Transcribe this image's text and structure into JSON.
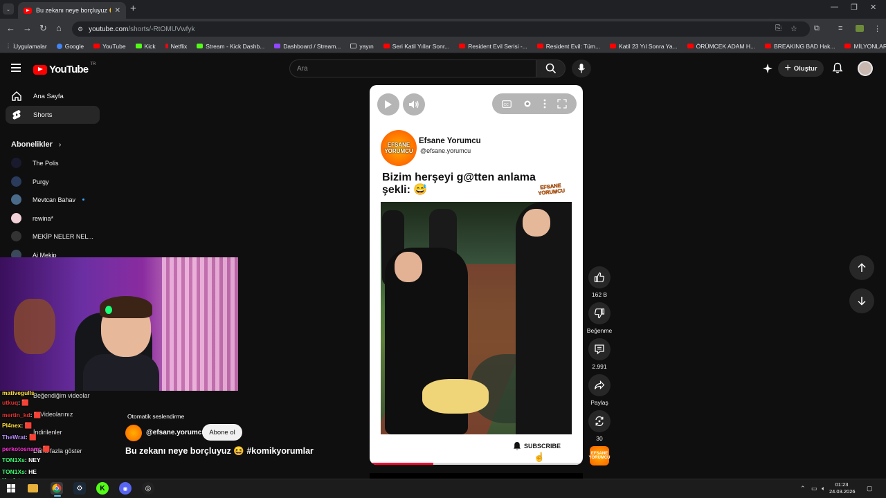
{
  "browser": {
    "tab_title": "Bu zekanı neye borçluyuz 😆 #k",
    "url_host": "youtube.com",
    "url_path": "/shorts/-RtOMUVwfyk",
    "bookmarks": [
      {
        "label": "Uygulamalar",
        "icon": "grid-icon"
      },
      {
        "label": "Google",
        "icon": "google-icon"
      },
      {
        "label": "YouTube",
        "icon": "youtube-icon"
      },
      {
        "label": "Kick",
        "icon": "kick-icon"
      },
      {
        "label": "Netflix",
        "icon": "netflix-icon"
      },
      {
        "label": "Stream - Kick Dashb...",
        "icon": "kick-icon"
      },
      {
        "label": "Dashboard / Stream...",
        "icon": "dashboard-icon"
      },
      {
        "label": "yayın",
        "icon": "folder-icon"
      },
      {
        "label": "Seri Katil Yıllar Sonr...",
        "icon": "youtube-icon"
      },
      {
        "label": "Resident Evil Serisi -...",
        "icon": "youtube-icon"
      },
      {
        "label": "Resident Evil: Tüm...",
        "icon": "youtube-icon"
      },
      {
        "label": "Katil 23 Yıl Sonra Ya...",
        "icon": "youtube-icon"
      },
      {
        "label": "ÖRÜMCEK ADAM H...",
        "icon": "youtube-icon"
      },
      {
        "label": "BREAKING BAD Hak...",
        "icon": "youtube-icon"
      },
      {
        "label": "MİLYONLAR ÇALAR...",
        "icon": "youtube-icon"
      }
    ]
  },
  "yt": {
    "logo_text": "YouTube",
    "logo_region": "TR",
    "search_placeholder": "Ara",
    "create_label": "Oluştur",
    "sidebar": {
      "home": "Ana Sayfa",
      "shorts": "Shorts",
      "subscriptions_heading": "Abonelikler",
      "subs": [
        {
          "name": "The Polis",
          "color": "#1a1a2e"
        },
        {
          "name": "Purgy",
          "color": "#2a3b5c"
        },
        {
          "name": "Mevtcan Bahav",
          "color": "#4a6a8a"
        },
        {
          "name": "rewina*",
          "color": "#f2d0d8"
        },
        {
          "name": "MEKİP NELER NEL...",
          "color": "#333333"
        },
        {
          "name": "Ai Mekip",
          "color": "#3a4a5a"
        }
      ],
      "ghost_items": [
        "Beğendiğim videolar",
        "İndirilenler"
      ],
      "ghost_fragments": [
        "Videolarınız",
        "Daha fazla göster"
      ]
    },
    "short": {
      "channel_name": "Efsane Yorumcu",
      "channel_handle": "@efsane.yorumcu",
      "logo_text": "EFSANE YORUMCU",
      "caption": "Bizim herşeyi g@tten anlama şekli: 😅",
      "watermark": "EFSANE YORUMCU",
      "subscribe_label": "SUBSCRIBE",
      "progress": 0.3
    },
    "actions": {
      "likes": "162 B",
      "dislike": "Beğenme",
      "comments": "2.991",
      "share": "Paylaş",
      "remix": "30"
    },
    "meta": {
      "auto_dub": "Otomatik seslendirme",
      "handle": "@efsane.yorumcu",
      "subscribe": "Abone ol",
      "title": "Bu zekanı neye borçluyuz 😆 #komikyorumlar"
    }
  },
  "chat": [
    {
      "user": "mativegulls",
      "text": "",
      "cls": "u5"
    },
    {
      "user": "utkuq",
      "text": ": 🟥",
      "cls": "u1"
    },
    {
      "user": "mertin_kd",
      "text": ": 🟥",
      "cls": "u1"
    },
    {
      "user": "Pl4nex",
      "text": ": 🟥",
      "cls": "u5"
    },
    {
      "user": "TheWrat",
      "text": ": 🟥",
      "cls": "u3"
    },
    {
      "user": "perkotosnam",
      "text": ": 🟥",
      "cls": "u2"
    },
    {
      "user": "TON1Xs",
      "text": ": NEY",
      "cls": "u4"
    },
    {
      "user": "TON1Xs",
      "text": ": HE",
      "cls": "u4"
    },
    {
      "user": "Keefet",
      "text": "",
      "cls": "u4"
    }
  ],
  "taskbar": {
    "time": "01:23",
    "date": "24.03.2026"
  }
}
